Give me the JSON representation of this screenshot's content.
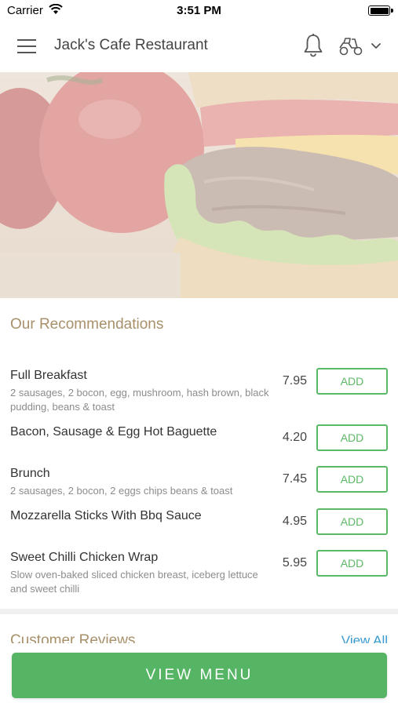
{
  "status_bar": {
    "carrier": "Carrier",
    "time": "3:51 PM"
  },
  "header": {
    "title": "Jack's Cafe Restaurant",
    "icons": [
      "hamburger-menu-icon",
      "bell-icon",
      "scooter-icon",
      "chevron-down-icon"
    ]
  },
  "hero": {
    "image": "burger-photo"
  },
  "recommendations": {
    "title": "Our Recommendations",
    "items": [
      {
        "name": "Full Breakfast",
        "desc": "2 sausages, 2 bocon, egg, mushroom, hash brown, black pudding, beans & toast",
        "price": "7.95",
        "button": "ADD"
      },
      {
        "name": "Bacon, Sausage & Egg Hot Baguette",
        "desc": "",
        "price": "4.20",
        "button": "ADD"
      },
      {
        "name": "Brunch",
        "desc": "2 sausages, 2 bocon, 2 eggs chips beans & toast",
        "price": "7.45",
        "button": "ADD"
      },
      {
        "name": "Mozzarella Sticks With Bbq Sauce",
        "desc": "",
        "price": "4.95",
        "button": "ADD"
      },
      {
        "name": "Sweet Chilli Chicken Wrap",
        "desc": "Slow oven-baked sliced chicken breast, iceberg lettuce and sweet chilli",
        "price": "5.95",
        "button": "ADD"
      }
    ]
  },
  "reviews": {
    "title": "Customer Reviews",
    "view_all": "View All"
  },
  "footer": {
    "view_menu": "VIEW MENU"
  },
  "colors": {
    "accent_green": "#55b565",
    "section_title": "#a8916a",
    "link_blue": "#3a9ad0"
  }
}
